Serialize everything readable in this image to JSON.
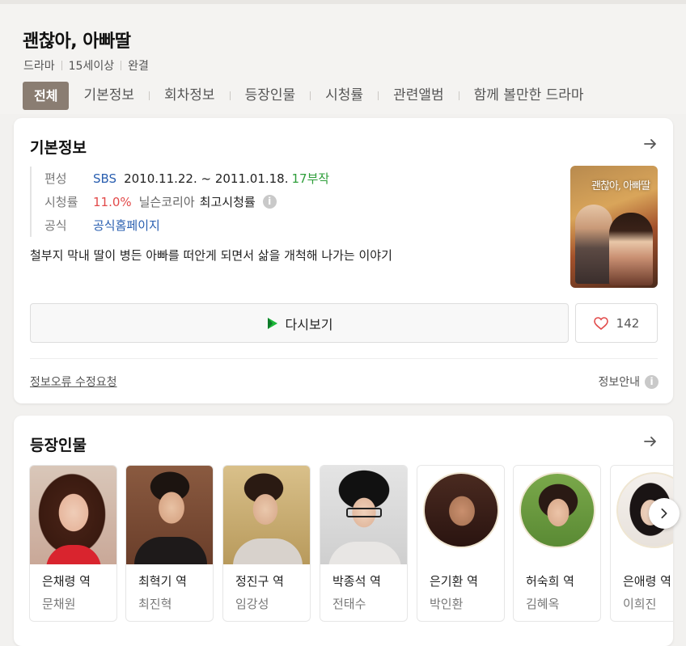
{
  "header": {
    "title": "괜찮아, 아빠딸",
    "meta": [
      "드라마",
      "15세이상",
      "완결"
    ],
    "tabs": [
      "전체",
      "기본정보",
      "회차정보",
      "등장인물",
      "시청률",
      "관련앨범",
      "함께 볼만한 드라마"
    ]
  },
  "basic_info": {
    "title": "기본정보",
    "broadcast_label": "편성",
    "broadcaster": "SBS",
    "period": "2010.11.22. ~ 2011.01.18.",
    "episodes": "17부작",
    "rating_label": "시청률",
    "rating_value": "11.0%",
    "rating_source": "닐슨코리아",
    "rating_type": "최고시청률",
    "official_label": "공식",
    "official_link": "공식홈페이지",
    "synopsis": "철부지 막내 딸이 병든 아빠를 떠안게 되면서 삶을 개척해 나가는 이야기",
    "replay_label": "다시보기",
    "like_count": "142",
    "error_report": "정보오류 수정요청",
    "info_guide": "정보안내"
  },
  "cast": {
    "title": "등장인물",
    "items": [
      {
        "role": "은채령 역",
        "actor": "문채원"
      },
      {
        "role": "최혁기 역",
        "actor": "최진혁"
      },
      {
        "role": "정진구 역",
        "actor": "임강성"
      },
      {
        "role": "박종석 역",
        "actor": "전태수"
      },
      {
        "role": "은기환 역",
        "actor": "박인환"
      },
      {
        "role": "허숙희 역",
        "actor": "김혜옥"
      },
      {
        "role": "은애령 역",
        "actor": "이희진"
      }
    ]
  },
  "colors": {
    "active_tab": "#8a7d72",
    "link_blue": "#2a5fb0",
    "episodes_green": "#2e9e3a",
    "rating_red": "#e24a4a",
    "heart": "#e24a4a",
    "replay_icon_green": "#1db83a"
  },
  "icons": [
    "arrow-right-icon",
    "info-icon",
    "play-icon",
    "heart-icon",
    "chevron-right-icon"
  ]
}
